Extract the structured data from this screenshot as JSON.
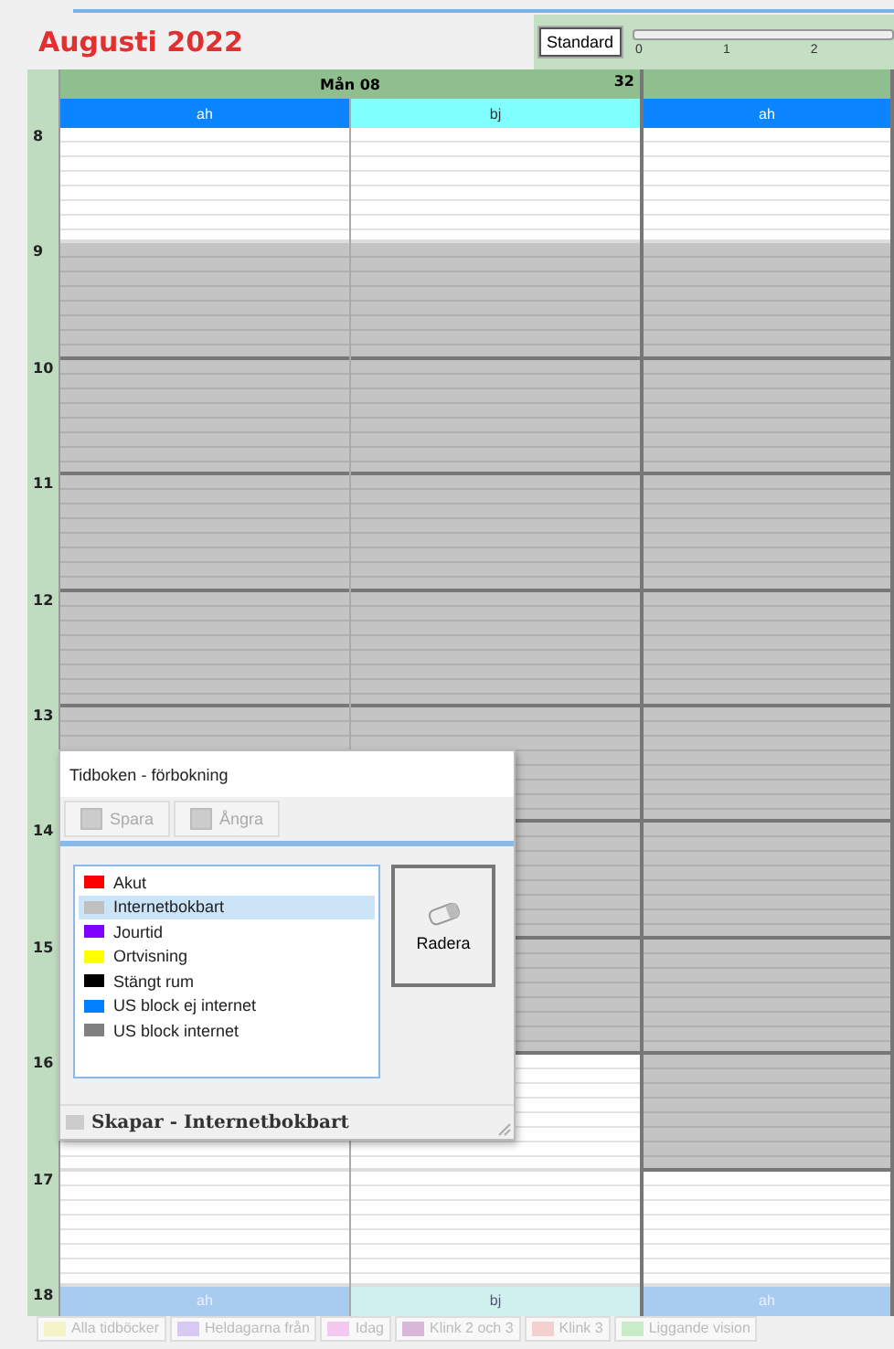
{
  "header": {
    "title": "Augusti 2022",
    "view_button": "Standard",
    "zoom_ticks": [
      "0",
      "1",
      "2"
    ]
  },
  "calendar": {
    "hours": [
      "8",
      "9",
      "10",
      "11",
      "12",
      "13",
      "14",
      "15",
      "16",
      "17"
    ],
    "footer_hour": "18",
    "days": [
      {
        "label": "Mån 08",
        "week": "32",
        "columns": [
          {
            "label": "ah",
            "footer_label": "ah",
            "color": "#0a84ff",
            "booked": [
              false,
              true,
              true,
              true,
              true,
              true
            ],
            "booked_below_dialog": [
              false,
              false
            ]
          },
          {
            "label": "bj",
            "footer_label": "bj",
            "color": "#80ffff",
            "booked": [
              false,
              true,
              true,
              true,
              true,
              true,
              true,
              true,
              false,
              false
            ]
          }
        ]
      },
      {
        "columns": [
          {
            "label": "ah",
            "footer_label": "ah",
            "color": "#0a84ff",
            "booked": [
              false,
              true,
              true,
              true,
              true,
              true,
              true,
              true,
              true,
              false
            ]
          }
        ]
      }
    ]
  },
  "legend_tabs": [
    {
      "label": "Alla tidböcker",
      "color": "#f4f4c8"
    },
    {
      "label": "Heldagarna från",
      "color": "#d8c8f4"
    },
    {
      "label": "Idag",
      "color": "#f4c8f0"
    },
    {
      "label": "Klink 2 och 3",
      "color": "#d8b8d8"
    },
    {
      "label": "Klink 3",
      "color": "#f4d0d0"
    },
    {
      "label": "Liggande vision",
      "color": "#c8ecc8"
    }
  ],
  "dialog": {
    "title": "Tidboken - förbokning",
    "toolbar": [
      {
        "label": "Spara",
        "disabled": true
      },
      {
        "label": "Ångra",
        "disabled": true
      }
    ],
    "items": [
      {
        "label": "Akut",
        "color": "#ff0000",
        "selected": false
      },
      {
        "label": "Internetbokbart",
        "color": "#c0c0c0",
        "selected": true
      },
      {
        "label": "Jourtid",
        "color": "#8000ff",
        "selected": false
      },
      {
        "label": "Ortvisning",
        "color": "#ffff00",
        "selected": false
      },
      {
        "label": "Stängt rum",
        "color": "#000000",
        "selected": false
      },
      {
        "label": "US block ej internet",
        "color": "#0080ff",
        "selected": false
      },
      {
        "label": "US block internet",
        "color": "#808080",
        "selected": false
      }
    ],
    "delete_button": "Radera",
    "status": "Skapar - Internetbokbart"
  }
}
